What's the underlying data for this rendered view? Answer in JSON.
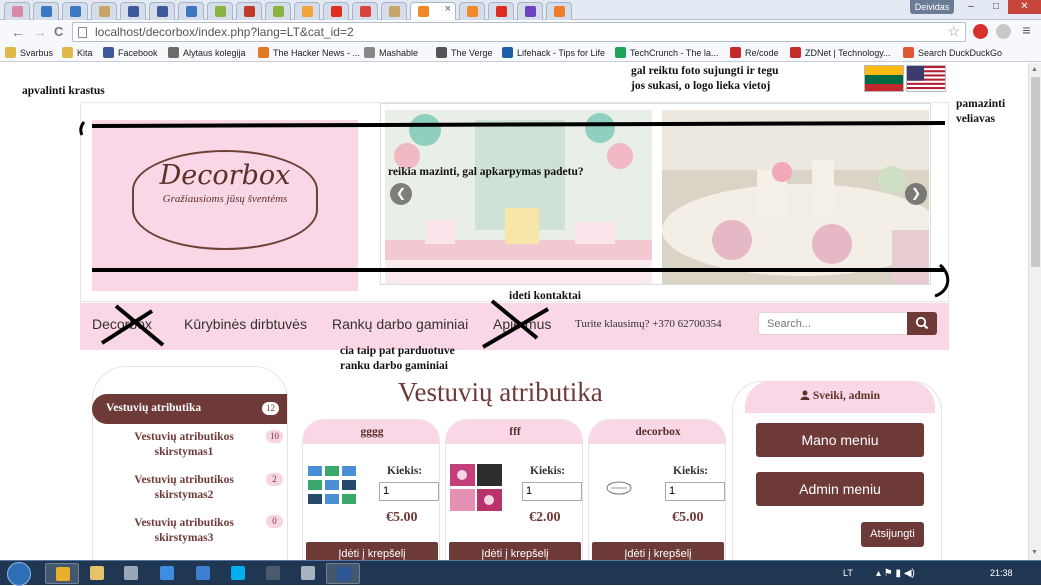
{
  "browser": {
    "user_label": "Deividas",
    "window_buttons": {
      "minimize": "–",
      "maximize": "□",
      "close": "✕"
    },
    "tabs": [
      {
        "icon": "blog-icon",
        "color": "#d98aa9"
      },
      {
        "icon": "doc-icon",
        "color": "#3b78c2"
      },
      {
        "icon": "doc-icon",
        "color": "#3b78c2"
      },
      {
        "icon": "pma-icon",
        "color": "#c7a468"
      },
      {
        "icon": "facebook-icon",
        "color": "#3b5998"
      },
      {
        "icon": "facebook-icon",
        "color": "#3b5998"
      },
      {
        "icon": "doc-icon",
        "color": "#3b78c2"
      },
      {
        "icon": "cart-icon",
        "color": "#8ab341"
      },
      {
        "icon": "chart-icon",
        "color": "#c0392b"
      },
      {
        "icon": "cart-icon",
        "color": "#8ab341"
      },
      {
        "icon": "audio-icon",
        "color": "#f2a33a"
      },
      {
        "icon": "youtube-icon",
        "color": "#e02b20"
      },
      {
        "icon": "gmail-icon",
        "color": "#d9443b"
      },
      {
        "icon": "pma-icon",
        "color": "#c7a468"
      },
      {
        "icon": "xampp-icon",
        "color": "#f08a24",
        "active": true,
        "close": "×"
      },
      {
        "icon": "xampp-icon",
        "color": "#f08a24"
      },
      {
        "icon": "youtube-icon",
        "color": "#e02b20"
      },
      {
        "icon": "bootstrap-icon",
        "color": "#6f42c1"
      },
      {
        "icon": "blogger-icon",
        "color": "#ef7b2d"
      }
    ],
    "address": "localhost/decorbox/index.php?lang=LT&cat_id=2",
    "back_icon": "←",
    "forward_icon": "→",
    "reload_icon": "C",
    "star_icon": "☆",
    "bookmarks": [
      {
        "label": "Svarbus",
        "color": "#e0b84a"
      },
      {
        "label": "Kita",
        "color": "#e0b84a"
      },
      {
        "label": "Facebook",
        "color": "#3b5998"
      },
      {
        "label": "Alytaus kolegija",
        "color": "#6a6a6a"
      },
      {
        "label": "The Hacker News - ...",
        "color": "#e07b24"
      },
      {
        "label": "Mashable",
        "color": "#888888"
      },
      {
        "label": "The Verge",
        "color": "#555555"
      },
      {
        "label": "Lifehack - Tips for Life",
        "color": "#1f5fa8"
      },
      {
        "label": "TechCrunch - The la...",
        "color": "#20a35b"
      },
      {
        "label": "Re/code",
        "color": "#c62b2b"
      },
      {
        "label": "ZDNet | Technology...",
        "color": "#c62b2b"
      },
      {
        "label": "Search DuckDuckGo",
        "color": "#de5833"
      }
    ]
  },
  "annotations": {
    "round_edges": "apvalinti krastus",
    "join_photos": "gal reiktu foto sujungti ir tegu jos sukasi, o logo lieka vietoj",
    "shrink_flags": "pamazinti veliavas",
    "reduce_crop": "reikia mazinti, gal apkarpymas padetu?",
    "add_contacts": "ideti kontaktai",
    "shop_note": "cia taip pat parduotuve ranku darbo gaminiai"
  },
  "logo": {
    "name": "Decorbox",
    "tagline": "Gražiausioms jūsų šventėms"
  },
  "slider": {
    "prev_icon": "❮",
    "next_icon": "❯"
  },
  "nav": {
    "items": [
      "Decorbox",
      "Kūrybinės dirbtuvės",
      "Rankų darbo gaminiai",
      "Apie mus"
    ],
    "question": "Turite klausimų? +370 62700354",
    "search_placeholder": "Search..."
  },
  "sidebar": {
    "categories": [
      {
        "label": "Vestuvių atributika",
        "count": "12",
        "active": true
      },
      {
        "label": "Vestuvių atributikos skirstymas1",
        "count": "10"
      },
      {
        "label": "Vestuvių atributikos skirstymas2",
        "count": "2"
      },
      {
        "label": "Vestuvių atributikos skirstymas3",
        "count": "0"
      }
    ]
  },
  "main": {
    "title": "Vestuvių atributika",
    "products": [
      {
        "name": "gggg",
        "qty_label": "Kiekis:",
        "qty": "1",
        "price": "€5.00",
        "button": "Įdėti į krepšelį"
      },
      {
        "name": "fff",
        "qty_label": "Kiekis:",
        "qty": "1",
        "price": "€2.00",
        "button": "Įdėti į krepšelį"
      },
      {
        "name": "decorbox",
        "qty_label": "Kiekis:",
        "qty": "1",
        "price": "€5.00",
        "button": "Įdėti į krepšelį"
      }
    ]
  },
  "user_panel": {
    "greeting": "Sveiki, admin",
    "my_menu": "Mano meniu",
    "admin_menu": "Admin meniu",
    "logout": "Atsijungti"
  },
  "taskbar": {
    "apps": [
      {
        "icon": "chrome-icon",
        "color": "#e8b02a",
        "open": true
      },
      {
        "icon": "explorer-icon",
        "color": "#e6c36a"
      },
      {
        "icon": "calculator-icon",
        "color": "#9aa7b6"
      },
      {
        "icon": "dropbox-icon",
        "color": "#3d8ee0"
      },
      {
        "icon": "cloud-icon",
        "color": "#3d7fd1"
      },
      {
        "icon": "skype-icon",
        "color": "#00aff0"
      },
      {
        "icon": "steam-icon",
        "color": "#4b5a6a"
      },
      {
        "icon": "pdf-icon",
        "color": "#a9b2bf"
      },
      {
        "icon": "word-icon",
        "color": "#2b5797",
        "open": true
      }
    ],
    "lang": "LT",
    "time": "21:38"
  }
}
